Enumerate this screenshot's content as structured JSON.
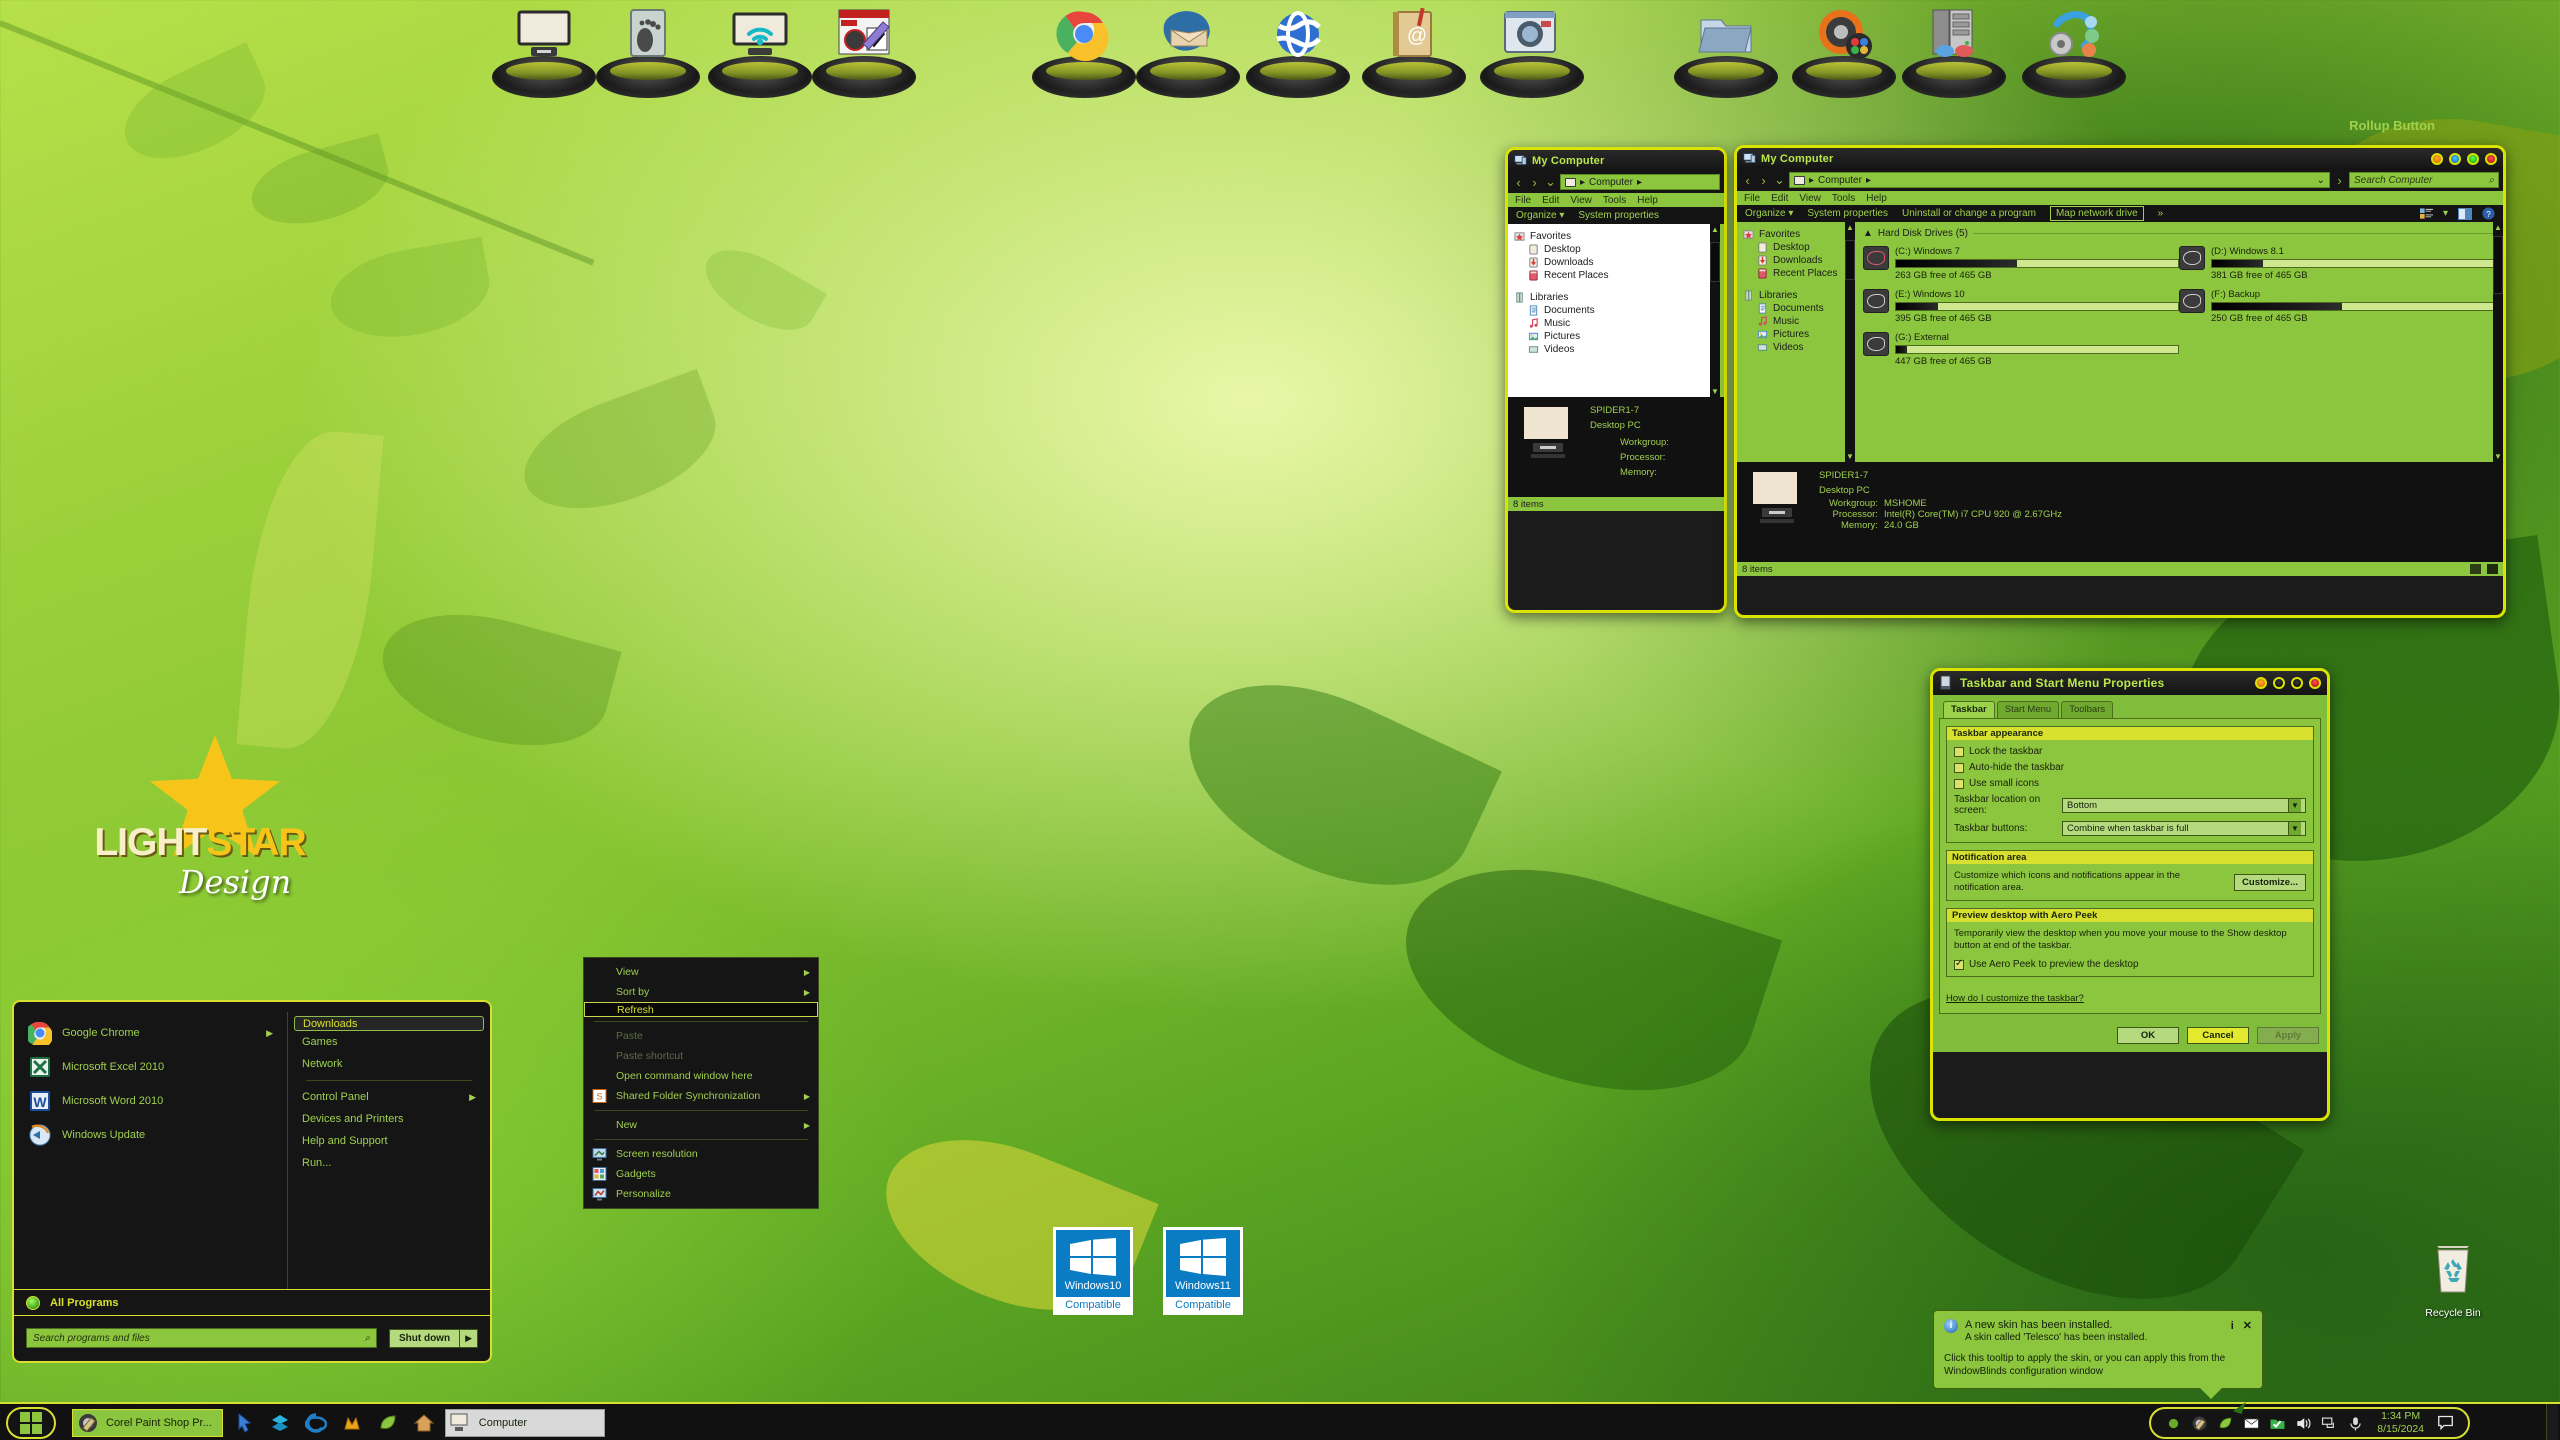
{
  "desktop": {
    "logo": {
      "part1": "LIGHT",
      "part2": "STAR",
      "script": "Design"
    },
    "rollup_label": "Rollup Button",
    "recycle_bin_label": "Recycle Bin",
    "badges": [
      {
        "os": "Windows10",
        "status": "Compatible"
      },
      {
        "os": "Windows11",
        "status": "Compatible"
      }
    ]
  },
  "dock": {
    "items": [
      {
        "name": "my-computer",
        "icon": "monitor-icon"
      },
      {
        "name": "footprint-drive",
        "icon": "footprint-icon"
      },
      {
        "name": "network-wifi",
        "icon": "wifi-monitor-icon"
      },
      {
        "name": "skinstudio",
        "icon": "skinstudio-icon"
      },
      {
        "name": "google-chrome",
        "icon": "chrome-icon"
      },
      {
        "name": "thunderbird",
        "icon": "thunderbird-icon"
      },
      {
        "name": "google-earth",
        "icon": "globe-icon"
      },
      {
        "name": "address-book",
        "icon": "addressbook-icon"
      },
      {
        "name": "camera",
        "icon": "camera-icon"
      },
      {
        "name": "folder",
        "icon": "folder-icon"
      },
      {
        "name": "objectdock",
        "icon": "objectdock-icon"
      },
      {
        "name": "server-3d",
        "icon": "server-glasses-icon"
      },
      {
        "name": "settings-suite",
        "icon": "gear-bubbles-icon"
      }
    ]
  },
  "explorer_back": {
    "title": "My Computer",
    "breadcrumb": "Computer",
    "menus": [
      "File",
      "Edit",
      "View",
      "Tools",
      "Help"
    ],
    "commands": [
      "Organize",
      "System properties"
    ],
    "nav_groups": [
      {
        "header": "Favorites",
        "items": [
          "Desktop",
          "Downloads",
          "Recent Places"
        ]
      },
      {
        "header": "Libraries",
        "items": [
          "Documents",
          "Music",
          "Pictures",
          "Videos"
        ]
      }
    ],
    "sysinfo": {
      "name": "SPIDER1-7",
      "type": "Desktop PC",
      "labels": [
        "Workgroup:",
        "Processor:",
        "Memory:"
      ]
    },
    "status": "8 items"
  },
  "explorer_front": {
    "title": "My Computer",
    "breadcrumb": "Computer",
    "search_placeholder": "Search Computer",
    "menus": [
      "File",
      "Edit",
      "View",
      "Tools",
      "Help"
    ],
    "commands": [
      "Organize",
      "System properties",
      "Uninstall or change a program"
    ],
    "command_boxed": "Map network drive",
    "overflow": "»",
    "nav_groups": [
      {
        "header": "Favorites",
        "items": [
          "Desktop",
          "Downloads",
          "Recent Places"
        ]
      },
      {
        "header": "Libraries",
        "items": [
          "Documents",
          "Music",
          "Pictures",
          "Videos"
        ]
      }
    ],
    "group_header": "Hard Disk Drives (5)",
    "drives": [
      {
        "name": "(C:) Windows 7",
        "free": "263 GB free of 465 GB",
        "used_pct": 43,
        "color": "red"
      },
      {
        "name": "(D:) Windows 8.1",
        "free": "381 GB free of 465 GB",
        "used_pct": 18,
        "color": "gray"
      },
      {
        "name": "(E:) Windows 10",
        "free": "395 GB free of 465 GB",
        "used_pct": 15,
        "color": "gray"
      },
      {
        "name": "(F:) Backup",
        "free": "250 GB free of 465 GB",
        "used_pct": 46,
        "color": "gray"
      },
      {
        "name": "(G:) External",
        "free": "447 GB free of 465 GB",
        "used_pct": 4,
        "color": "gray"
      }
    ],
    "sysinfo": {
      "name": "SPIDER1-7",
      "type": "Desktop PC",
      "rows": [
        {
          "label": "Workgroup:",
          "value": "MSHOME"
        },
        {
          "label": "Processor:",
          "value": "Intel(R) Core(TM) i7 CPU      920  @ 2.67GHz"
        },
        {
          "label": "Memory:",
          "value": "24.0 GB"
        }
      ]
    },
    "status": "8 items"
  },
  "taskbar_dialog": {
    "title": "Taskbar and Start Menu Properties",
    "tabs": [
      {
        "label": "Taskbar",
        "active": true
      },
      {
        "label": "Start Menu",
        "active": false
      },
      {
        "label": "Toolbars",
        "active": false
      }
    ],
    "appearance": {
      "group_title": "Taskbar appearance",
      "checkboxes": [
        {
          "label": "Lock the taskbar",
          "checked": false
        },
        {
          "label": "Auto-hide the taskbar",
          "checked": false
        },
        {
          "label": "Use small icons",
          "checked": false
        }
      ],
      "location_label": "Taskbar location on screen:",
      "location_value": "Bottom",
      "buttons_label": "Taskbar buttons:",
      "buttons_value": "Combine when taskbar is full"
    },
    "notification": {
      "group_title": "Notification area",
      "description": "Customize which icons and notifications appear in the notification area.",
      "button": "Customize..."
    },
    "aero": {
      "group_title": "Preview desktop with Aero Peek",
      "description": "Temporarily view the desktop when you move your mouse to the Show desktop button at end of the taskbar.",
      "checkbox": {
        "label": "Use Aero Peek to preview the desktop",
        "checked": true
      }
    },
    "help_link": "How do I customize the taskbar?",
    "footer": {
      "ok": "OK",
      "cancel": "Cancel",
      "apply": "Apply"
    }
  },
  "start_menu": {
    "left_items": [
      {
        "label": "Google Chrome",
        "icon": "chrome-icon",
        "submenu": true
      },
      {
        "label": "Microsoft Excel 2010",
        "icon": "excel-icon",
        "submenu": false
      },
      {
        "label": "Microsoft Word 2010",
        "icon": "word-icon",
        "submenu": false
      },
      {
        "label": "Windows Update",
        "icon": "windows-update-icon",
        "submenu": false
      }
    ],
    "right_items": [
      {
        "label": "Downloads",
        "selected": true,
        "submenu": false
      },
      {
        "label": "Games",
        "selected": false,
        "submenu": false
      },
      {
        "label": "Network",
        "selected": false,
        "submenu": false
      },
      {
        "label": "Control Panel",
        "selected": false,
        "submenu": true
      },
      {
        "label": "Devices and Printers",
        "selected": false,
        "submenu": false
      },
      {
        "label": "Help and Support",
        "selected": false,
        "submenu": false
      },
      {
        "label": "Run...",
        "selected": false,
        "submenu": false
      }
    ],
    "all_programs": "All Programs",
    "search_placeholder": "Search programs and files",
    "shutdown": "Shut down"
  },
  "context_menu": {
    "items": [
      {
        "label": "View",
        "submenu": true,
        "dim": false,
        "selected": false,
        "icon": null
      },
      {
        "label": "Sort by",
        "submenu": true,
        "dim": false,
        "selected": false,
        "icon": null
      },
      {
        "label": "Refresh",
        "submenu": false,
        "dim": false,
        "selected": true,
        "icon": null
      },
      {
        "separator": true
      },
      {
        "label": "Paste",
        "submenu": false,
        "dim": true,
        "selected": false,
        "icon": null
      },
      {
        "label": "Paste shortcut",
        "submenu": false,
        "dim": true,
        "selected": false,
        "icon": null
      },
      {
        "label": "Open command window here",
        "submenu": false,
        "dim": false,
        "selected": false,
        "icon": null
      },
      {
        "label": "Shared Folder Synchronization",
        "submenu": true,
        "dim": false,
        "selected": false,
        "icon": "sync-icon"
      },
      {
        "separator": true
      },
      {
        "label": "New",
        "submenu": true,
        "dim": false,
        "selected": false,
        "icon": null
      },
      {
        "separator": true
      },
      {
        "label": "Screen resolution",
        "submenu": false,
        "dim": false,
        "selected": false,
        "icon": "monitor-icon"
      },
      {
        "label": "Gadgets",
        "submenu": false,
        "dim": false,
        "selected": false,
        "icon": "gadgets-icon"
      },
      {
        "label": "Personalize",
        "submenu": false,
        "dim": false,
        "selected": false,
        "icon": "personalize-icon"
      }
    ]
  },
  "balloon": {
    "title": "A new skin has been installed.",
    "subtitle": "A skin called 'Telesco' has been installed.",
    "body": "Click this tooltip to apply the skin, or you can apply this from the WindowBlinds configuration window",
    "info_glyph": "i",
    "close_glyph": "✕"
  },
  "taskbar": {
    "start_label": "Start",
    "buttons": [
      {
        "label": "Corel Paint Shop Pr...",
        "icon": "paintshop-icon",
        "active": true
      },
      {
        "label": "Computer",
        "icon": "computer-icon",
        "active": false
      }
    ],
    "quicklaunch": [
      {
        "name": "cursor-fx",
        "icon": "cursorfx-icon"
      },
      {
        "name": "deskscapes",
        "icon": "deskscapes-icon"
      },
      {
        "name": "internet-explorer",
        "icon": "ie-icon"
      },
      {
        "name": "fences",
        "icon": "fences-icon"
      },
      {
        "name": "leaf-app",
        "icon": "leaf-icon"
      },
      {
        "name": "home-app",
        "icon": "home-icon"
      }
    ],
    "tray": [
      {
        "name": "tray-show-hidden",
        "icon": "circle-icon"
      },
      {
        "name": "tray-paintshop",
        "icon": "paintshop-icon"
      },
      {
        "name": "tray-leaf",
        "icon": "leaf-icon"
      },
      {
        "name": "tray-mail",
        "icon": "envelope-icon"
      },
      {
        "name": "tray-checkmark",
        "icon": "check-folder-icon"
      },
      {
        "name": "tray-volume",
        "icon": "speaker-icon"
      },
      {
        "name": "tray-network",
        "icon": "network-icon"
      },
      {
        "name": "tray-microphone",
        "icon": "microphone-icon"
      }
    ],
    "clock": {
      "time": "1:34 PM",
      "date": "8/15/2024"
    },
    "action_center": "action-center-icon"
  },
  "colors": {
    "accent_yellow": "#d7e02e",
    "green_face": "#8cc63e",
    "dark_chrome": "#151515",
    "text_green": "#9fd04e"
  }
}
